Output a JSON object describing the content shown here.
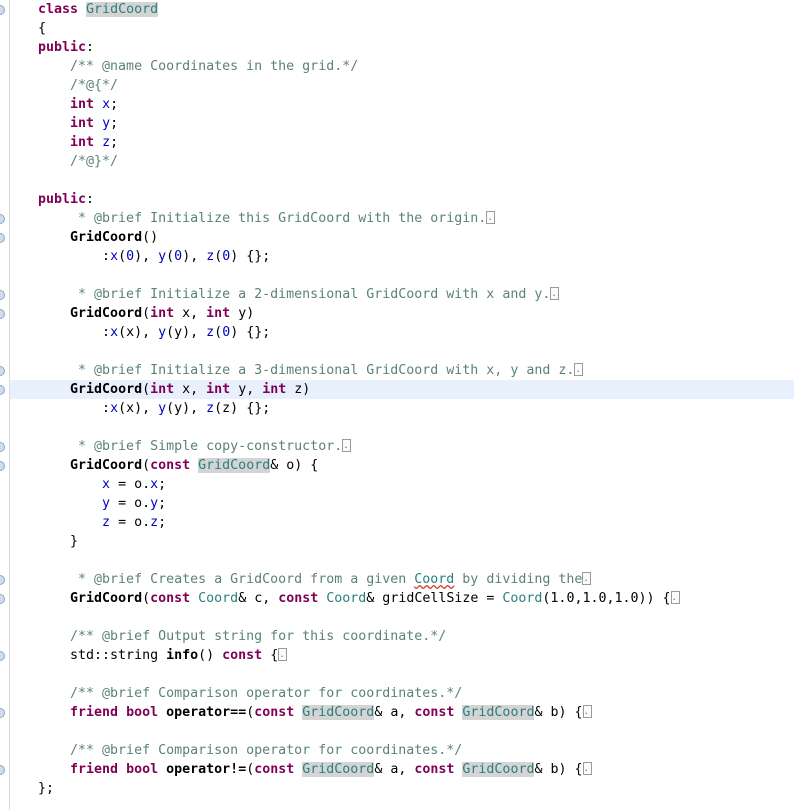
{
  "editor": {
    "language": "cpp",
    "colors": {
      "background": "#ffffff",
      "keyword": "#7f0055",
      "comment": "#5b8278",
      "type": "#2a7f7f",
      "variable": "#0000c0",
      "occurrence_highlight": "#d4d4d4",
      "current_line_highlight": "#e8f0fd",
      "spell_error_underline": "#d43b25",
      "gutter_border": "#dcdcdc",
      "fold_marker": "#cfdcec"
    },
    "current_line_index": 20,
    "fold_marker_lines": [
      0,
      11,
      12,
      15,
      16,
      19,
      20,
      23,
      24,
      30,
      31,
      34,
      37,
      40
    ],
    "fold_box_glyph": ".."
  },
  "code": {
    "lines": [
      {
        "i": 0,
        "tokens": [
          {
            "t": "class ",
            "c": "kw"
          },
          {
            "t": "GridCoord",
            "c": "cls"
          }
        ]
      },
      {
        "i": 1,
        "tokens": [
          {
            "t": "{",
            "c": "plain"
          }
        ]
      },
      {
        "i": 2,
        "tokens": [
          {
            "t": "public",
            "c": "kw"
          },
          {
            "t": ":",
            "c": "plain"
          }
        ]
      },
      {
        "i": 3,
        "tokens": [
          {
            "t": "    /** @name Coordinates in the grid.*/",
            "c": "cmt"
          }
        ]
      },
      {
        "i": 4,
        "tokens": [
          {
            "t": "    /*@{*/",
            "c": "cmt"
          }
        ]
      },
      {
        "i": 5,
        "tokens": [
          {
            "t": "    ",
            "c": "plain"
          },
          {
            "t": "int",
            "c": "kw"
          },
          {
            "t": " ",
            "c": "plain"
          },
          {
            "t": "x",
            "c": "var"
          },
          {
            "t": ";",
            "c": "plain"
          }
        ]
      },
      {
        "i": 6,
        "tokens": [
          {
            "t": "    ",
            "c": "plain"
          },
          {
            "t": "int",
            "c": "kw"
          },
          {
            "t": " ",
            "c": "plain"
          },
          {
            "t": "y",
            "c": "var"
          },
          {
            "t": ";",
            "c": "plain"
          }
        ]
      },
      {
        "i": 7,
        "tokens": [
          {
            "t": "    ",
            "c": "plain"
          },
          {
            "t": "int",
            "c": "kw"
          },
          {
            "t": " ",
            "c": "plain"
          },
          {
            "t": "z",
            "c": "var"
          },
          {
            "t": ";",
            "c": "plain"
          }
        ]
      },
      {
        "i": 8,
        "tokens": [
          {
            "t": "    /*@}*/",
            "c": "cmt"
          }
        ]
      },
      {
        "i": 9,
        "tokens": []
      },
      {
        "i": 10,
        "tokens": [
          {
            "t": "public",
            "c": "kw"
          },
          {
            "t": ":",
            "c": "plain"
          }
        ]
      },
      {
        "i": 11,
        "tokens": [
          {
            "t": "     * @brief Initialize this GridCoord with the origin.",
            "c": "cmt"
          },
          {
            "t": "",
            "c": "fold"
          }
        ]
      },
      {
        "i": 12,
        "tokens": [
          {
            "t": "    ",
            "c": "plain"
          },
          {
            "t": "GridCoord",
            "c": "fn"
          },
          {
            "t": "()",
            "c": "plain"
          }
        ]
      },
      {
        "i": 13,
        "tokens": [
          {
            "t": "        :",
            "c": "plain"
          },
          {
            "t": "x",
            "c": "var"
          },
          {
            "t": "(",
            "c": "plain"
          },
          {
            "t": "0",
            "c": "num"
          },
          {
            "t": "), ",
            "c": "plain"
          },
          {
            "t": "y",
            "c": "var"
          },
          {
            "t": "(",
            "c": "plain"
          },
          {
            "t": "0",
            "c": "num"
          },
          {
            "t": "), ",
            "c": "plain"
          },
          {
            "t": "z",
            "c": "var"
          },
          {
            "t": "(",
            "c": "plain"
          },
          {
            "t": "0",
            "c": "num"
          },
          {
            "t": ") {};",
            "c": "plain"
          }
        ]
      },
      {
        "i": 14,
        "tokens": []
      },
      {
        "i": 15,
        "tokens": [
          {
            "t": "     * @brief Initialize a 2-dimensional GridCoord with x and y.",
            "c": "cmt"
          },
          {
            "t": "",
            "c": "fold"
          }
        ]
      },
      {
        "i": 16,
        "tokens": [
          {
            "t": "    ",
            "c": "plain"
          },
          {
            "t": "GridCoord",
            "c": "fn"
          },
          {
            "t": "(",
            "c": "plain"
          },
          {
            "t": "int",
            "c": "kw"
          },
          {
            "t": " x, ",
            "c": "plain"
          },
          {
            "t": "int",
            "c": "kw"
          },
          {
            "t": " y)",
            "c": "plain"
          }
        ]
      },
      {
        "i": 17,
        "tokens": [
          {
            "t": "        :",
            "c": "plain"
          },
          {
            "t": "x",
            "c": "var"
          },
          {
            "t": "(x), ",
            "c": "plain"
          },
          {
            "t": "y",
            "c": "var"
          },
          {
            "t": "(y), ",
            "c": "plain"
          },
          {
            "t": "z",
            "c": "var"
          },
          {
            "t": "(",
            "c": "plain"
          },
          {
            "t": "0",
            "c": "num"
          },
          {
            "t": ") {};",
            "c": "plain"
          }
        ]
      },
      {
        "i": 18,
        "tokens": []
      },
      {
        "i": 19,
        "tokens": [
          {
            "t": "     * @brief Initialize a 3-dimensional GridCoord with x, y and z.",
            "c": "cmt"
          },
          {
            "t": "",
            "c": "fold"
          }
        ]
      },
      {
        "i": 20,
        "tokens": [
          {
            "t": "    ",
            "c": "plain"
          },
          {
            "t": "GridCoord",
            "c": "fn"
          },
          {
            "t": "(",
            "c": "plain"
          },
          {
            "t": "int",
            "c": "kw"
          },
          {
            "t": " x, ",
            "c": "plain"
          },
          {
            "t": "int",
            "c": "kw"
          },
          {
            "t": " y, ",
            "c": "plain"
          },
          {
            "t": "int",
            "c": "kw"
          },
          {
            "t": " z)",
            "c": "plain"
          }
        ]
      },
      {
        "i": 21,
        "tokens": [
          {
            "t": "        :",
            "c": "plain"
          },
          {
            "t": "x",
            "c": "var"
          },
          {
            "t": "(x), ",
            "c": "plain"
          },
          {
            "t": "y",
            "c": "var"
          },
          {
            "t": "(y), ",
            "c": "plain"
          },
          {
            "t": "z",
            "c": "var"
          },
          {
            "t": "(z) {};",
            "c": "plain"
          }
        ]
      },
      {
        "i": 22,
        "tokens": []
      },
      {
        "i": 23,
        "tokens": [
          {
            "t": "     * @brief Simple copy-constructor.",
            "c": "cmt"
          },
          {
            "t": "",
            "c": "fold"
          }
        ]
      },
      {
        "i": 24,
        "tokens": [
          {
            "t": "    ",
            "c": "plain"
          },
          {
            "t": "GridCoord",
            "c": "fn"
          },
          {
            "t": "(",
            "c": "plain"
          },
          {
            "t": "const",
            "c": "kw"
          },
          {
            "t": " ",
            "c": "plain"
          },
          {
            "t": "GridCoord",
            "c": "cls"
          },
          {
            "t": "& o) {",
            "c": "plain"
          }
        ]
      },
      {
        "i": 25,
        "tokens": [
          {
            "t": "        ",
            "c": "plain"
          },
          {
            "t": "x",
            "c": "var"
          },
          {
            "t": " = o.",
            "c": "plain"
          },
          {
            "t": "x",
            "c": "var"
          },
          {
            "t": ";",
            "c": "plain"
          }
        ]
      },
      {
        "i": 26,
        "tokens": [
          {
            "t": "        ",
            "c": "plain"
          },
          {
            "t": "y",
            "c": "var"
          },
          {
            "t": " = o.",
            "c": "plain"
          },
          {
            "t": "y",
            "c": "var"
          },
          {
            "t": ";",
            "c": "plain"
          }
        ]
      },
      {
        "i": 27,
        "tokens": [
          {
            "t": "        ",
            "c": "plain"
          },
          {
            "t": "z",
            "c": "var"
          },
          {
            "t": " = o.",
            "c": "plain"
          },
          {
            "t": "z",
            "c": "var"
          },
          {
            "t": ";",
            "c": "plain"
          }
        ]
      },
      {
        "i": 28,
        "tokens": [
          {
            "t": "    }",
            "c": "plain"
          }
        ]
      },
      {
        "i": 29,
        "tokens": []
      },
      {
        "i": 30,
        "tokens": [
          {
            "t": "     * @brief Creates a GridCoord from a given ",
            "c": "cmt"
          },
          {
            "t": "Coord",
            "c": "misspell"
          },
          {
            "t": " by dividing the",
            "c": "cmt"
          },
          {
            "t": "",
            "c": "fold"
          }
        ]
      },
      {
        "i": 31,
        "tokens": [
          {
            "t": "    ",
            "c": "plain"
          },
          {
            "t": "GridCoord",
            "c": "fn"
          },
          {
            "t": "(",
            "c": "plain"
          },
          {
            "t": "const",
            "c": "kw"
          },
          {
            "t": " ",
            "c": "plain"
          },
          {
            "t": "Coord",
            "c": "type"
          },
          {
            "t": "& c, ",
            "c": "plain"
          },
          {
            "t": "const",
            "c": "kw"
          },
          {
            "t": " ",
            "c": "plain"
          },
          {
            "t": "Coord",
            "c": "type"
          },
          {
            "t": "& gridCellSize = ",
            "c": "plain"
          },
          {
            "t": "Coord",
            "c": "type"
          },
          {
            "t": "(1.0,1.0,1.0)) {",
            "c": "plain"
          },
          {
            "t": "",
            "c": "fold"
          }
        ]
      },
      {
        "i": 32,
        "tokens": []
      },
      {
        "i": 33,
        "tokens": [
          {
            "t": "    /** @brief Output string for this coordinate.*/",
            "c": "cmt"
          }
        ]
      },
      {
        "i": 34,
        "tokens": [
          {
            "t": "    std::string ",
            "c": "plain"
          },
          {
            "t": "info",
            "c": "fn"
          },
          {
            "t": "() ",
            "c": "plain"
          },
          {
            "t": "const",
            "c": "kw"
          },
          {
            "t": " {",
            "c": "plain"
          },
          {
            "t": "",
            "c": "fold"
          }
        ]
      },
      {
        "i": 35,
        "tokens": []
      },
      {
        "i": 36,
        "tokens": [
          {
            "t": "    /** @brief Comparison operator for coordinates.*/",
            "c": "cmt"
          }
        ]
      },
      {
        "i": 37,
        "tokens": [
          {
            "t": "    ",
            "c": "plain"
          },
          {
            "t": "friend",
            "c": "kw"
          },
          {
            "t": " ",
            "c": "plain"
          },
          {
            "t": "bool",
            "c": "kw"
          },
          {
            "t": " ",
            "c": "plain"
          },
          {
            "t": "operator==",
            "c": "fn"
          },
          {
            "t": "(",
            "c": "plain"
          },
          {
            "t": "const",
            "c": "kw"
          },
          {
            "t": " ",
            "c": "plain"
          },
          {
            "t": "GridCoord",
            "c": "cls"
          },
          {
            "t": "& a, ",
            "c": "plain"
          },
          {
            "t": "const",
            "c": "kw"
          },
          {
            "t": " ",
            "c": "plain"
          },
          {
            "t": "GridCoord",
            "c": "cls"
          },
          {
            "t": "& b) {",
            "c": "plain"
          },
          {
            "t": "",
            "c": "fold"
          }
        ]
      },
      {
        "i": 38,
        "tokens": []
      },
      {
        "i": 39,
        "tokens": [
          {
            "t": "    /** @brief Comparison operator for coordinates.*/",
            "c": "cmt"
          }
        ]
      },
      {
        "i": 40,
        "tokens": [
          {
            "t": "    ",
            "c": "plain"
          },
          {
            "t": "friend",
            "c": "kw"
          },
          {
            "t": " ",
            "c": "plain"
          },
          {
            "t": "bool",
            "c": "kw"
          },
          {
            "t": " ",
            "c": "plain"
          },
          {
            "t": "operator!=",
            "c": "fn"
          },
          {
            "t": "(",
            "c": "plain"
          },
          {
            "t": "const",
            "c": "kw"
          },
          {
            "t": " ",
            "c": "plain"
          },
          {
            "t": "GridCoord",
            "c": "cls"
          },
          {
            "t": "& a, ",
            "c": "plain"
          },
          {
            "t": "const",
            "c": "kw"
          },
          {
            "t": " ",
            "c": "plain"
          },
          {
            "t": "GridCoord",
            "c": "cls"
          },
          {
            "t": "& b) {",
            "c": "plain"
          },
          {
            "t": "",
            "c": "fold"
          }
        ]
      },
      {
        "i": 41,
        "tokens": [
          {
            "t": "};",
            "c": "plain"
          }
        ]
      }
    ]
  }
}
